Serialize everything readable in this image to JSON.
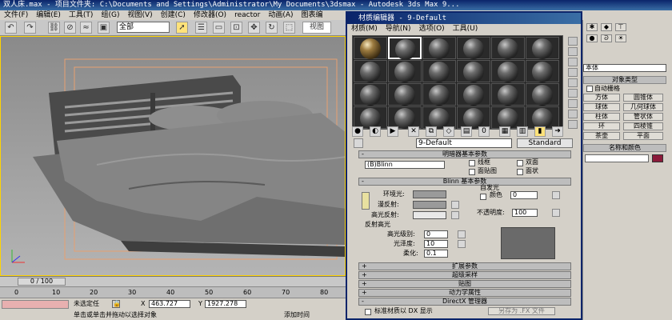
{
  "app": {
    "title": "双人床.max  - 项目文件夹: C:\\Documents and Settings\\Administrator\\My Documents\\3dsmax   - Autodesk 3ds Max 9..."
  },
  "menu": [
    "文件(F)",
    "编辑(E)",
    "工具(T)",
    "组(G)",
    "视图(V)",
    "创建(C)",
    "修改器(O)",
    "reactor",
    "动画(A)",
    "图表编"
  ],
  "toolbar": {
    "selection_filter": "全部",
    "view_label": "视图"
  },
  "viewport": {
    "time_slider": "0 / 100",
    "ruler_ticks": [
      "0",
      "10",
      "20",
      "30",
      "40",
      "50",
      "60",
      "70",
      "80"
    ]
  },
  "status": {
    "selection": "未选定任",
    "x_label": "X",
    "x_value": "463.727",
    "y_label": "Y",
    "y_value": "1927.278",
    "prompt": "单击或单击并拖动以选择对象",
    "z_hint": "添加时间"
  },
  "material_editor": {
    "title": "材质编辑器 - 9-Default",
    "menu": [
      "材质(M)",
      "导航(N)",
      "选项(O)",
      "工具(U)"
    ],
    "material_name": "9-Default",
    "material_type": "Standard",
    "shader_rollout": "明暗器基本参数",
    "shader_type": "(B)Blinn",
    "wire_label": "线框",
    "two_sided_label": "双面",
    "face_map_label": "面贴图",
    "faceted_label": "面状",
    "blinn_rollout": "Blinn 基本参数",
    "self_illum_label": "自发光",
    "color_label": "颜色",
    "color_value": "0",
    "ambient_label": "环境光:",
    "diffuse_label": "漫反射:",
    "specular_label": "高光反射:",
    "opacity_label": "不透明度:",
    "opacity_value": "100",
    "spec_highlights_label": "反射高光",
    "spec_level_label": "高光级别:",
    "spec_level_value": "0",
    "glossiness_label": "光泽度:",
    "glossiness_value": "10",
    "soften_label": "柔化:",
    "soften_value": "0.1",
    "rollouts": [
      "扩展参数",
      "超级采样",
      "贴图",
      "动力学属性",
      "DirectX 管理器"
    ],
    "dx_checkbox_label": "标准材质以 DX 显示",
    "save_as_fx": "另存为 .FX 文件"
  },
  "command_panel": {
    "category_select": "本体",
    "auto_grid": "自动栅格",
    "object_type_header": "对象类型",
    "buttons": [
      "方体",
      "圆锥体",
      "球体",
      "几何球体",
      "柱体",
      "管状体",
      "环",
      "四棱锥",
      "茶壶",
      "平面"
    ],
    "name_color_header": "名称和颜色",
    "color_swatch": "#8b1a3a"
  },
  "colors": {
    "accent": "#0a246a",
    "viewport_border": "#ffd400"
  }
}
